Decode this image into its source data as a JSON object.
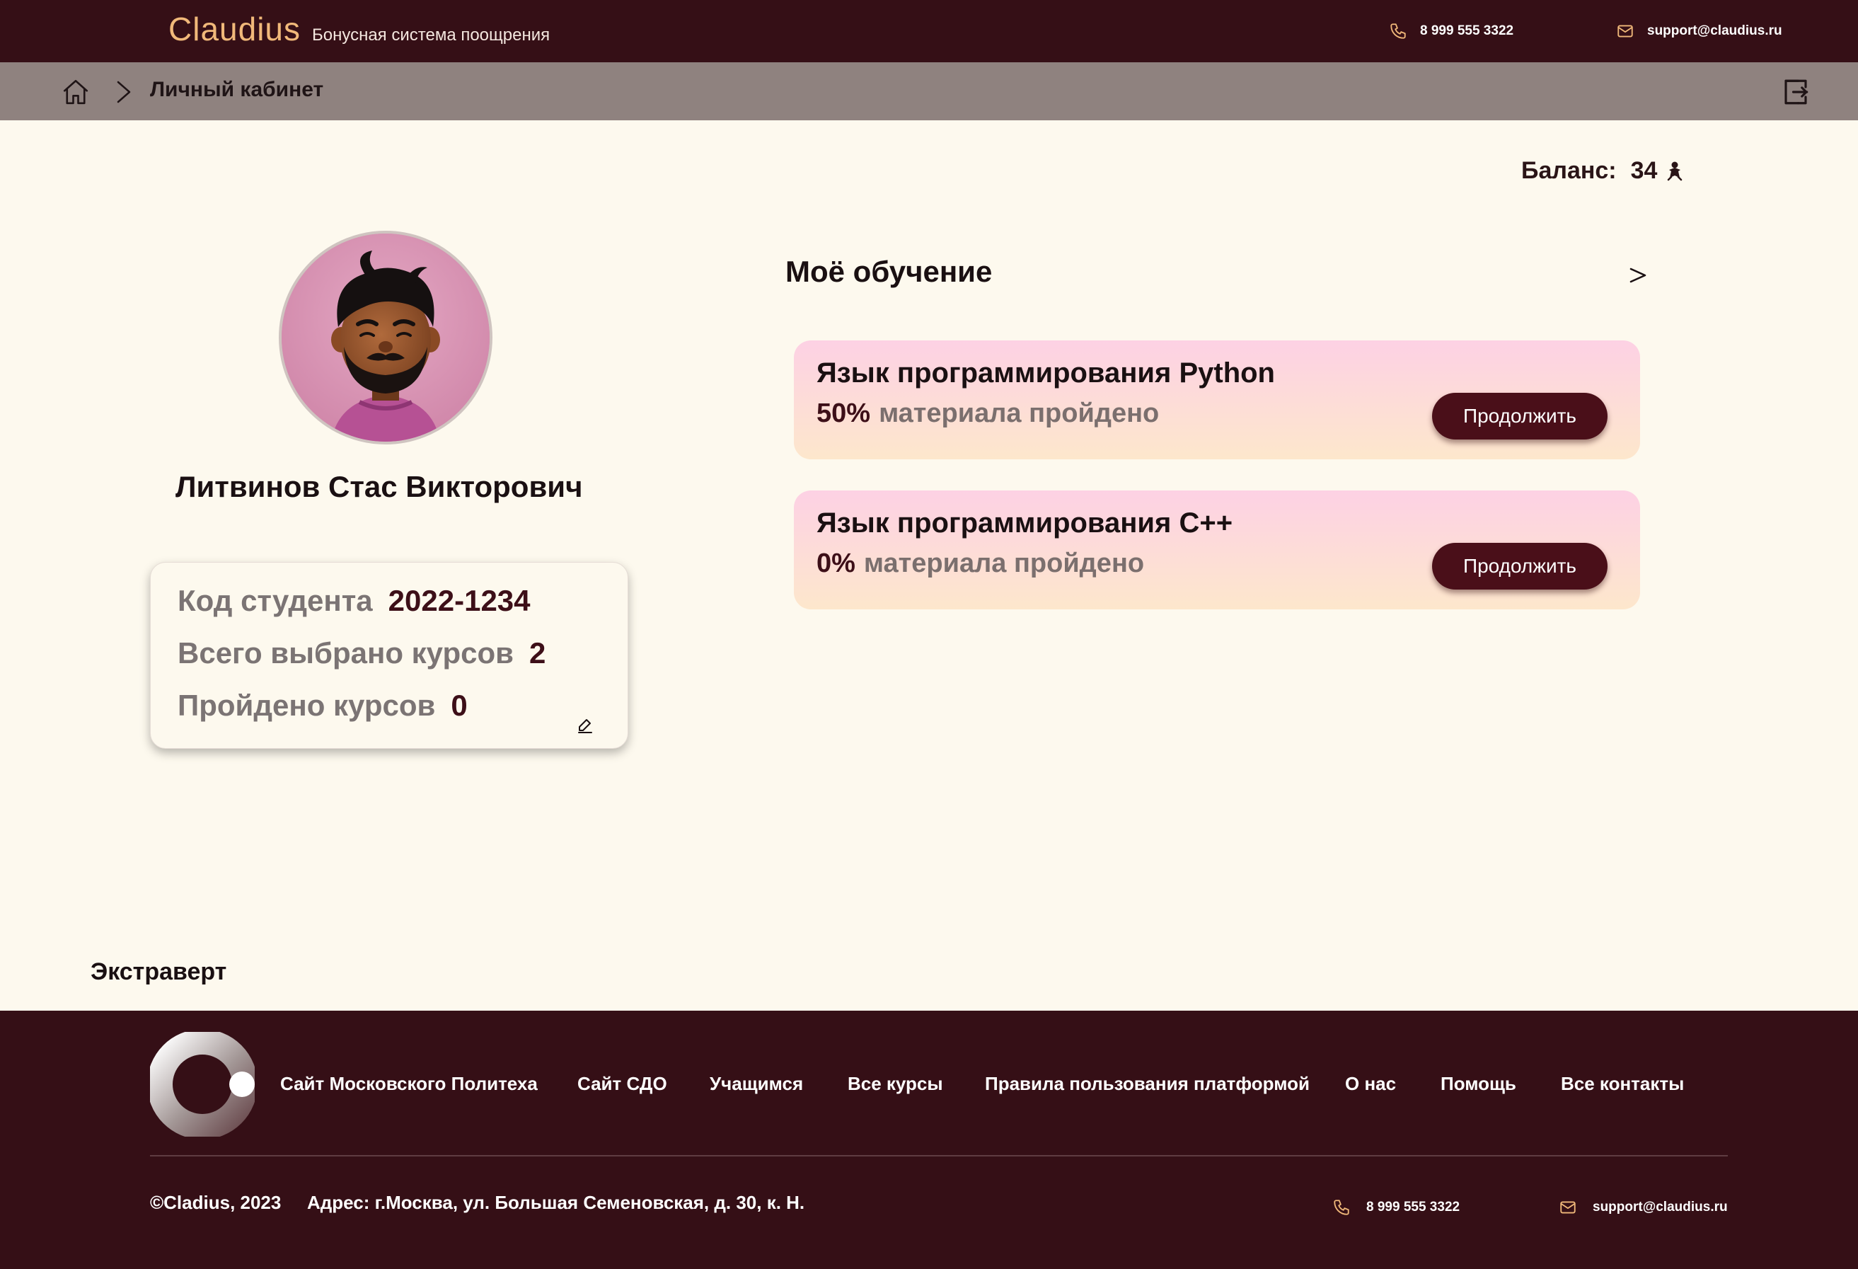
{
  "header": {
    "brand_name": "Claudius",
    "brand_subtitle": "Бонусная система поощрения",
    "phone": "8 999 555 3322",
    "email": "support@claudius.ru"
  },
  "breadcrumb": {
    "current": "Личный кабинет"
  },
  "balance": {
    "label": "Баланс:",
    "value": "34"
  },
  "profile": {
    "name": "Литвинов Стас Викторович",
    "stats": [
      {
        "label": "Код студента",
        "value": "2022-1234"
      },
      {
        "label": "Всего выбрано курсов",
        "value": "2"
      },
      {
        "label": "Пройдено курсов",
        "value": "0"
      }
    ],
    "trait": "Экстраверт"
  },
  "learning": {
    "title": "Моё обучение",
    "arrow": ">",
    "courses": [
      {
        "title": "Язык программирования Python",
        "progress": "50%",
        "progress_text": "материала пройдено",
        "button": "Продолжить"
      },
      {
        "title": "Язык программирования C++",
        "progress": "0%",
        "progress_text": "материала пройдено",
        "button": "Продолжить"
      }
    ]
  },
  "footer": {
    "nav": [
      "Сайт Московского Политеха",
      "Сайт СДО",
      "Учащимся",
      "Все курсы",
      "Правила пользования платформой",
      "О нас",
      "Помощь",
      "Все контакты"
    ],
    "copyright": "©Cladius, 2023",
    "address": "Адрес: г.Москва, ул. Большая Семеновская, д. 30, к. Н.",
    "phone": "8 999 555 3322",
    "email": "support@claudius.ru"
  },
  "colors": {
    "header_bg": "#350f16",
    "breadcrumb_bg": "#8f827f",
    "page_bg": "#fdf9ee",
    "brand_accent": "#f1b97a",
    "button_bg": "#4a0f19",
    "card_gradient_top": "#fdd1e4",
    "card_gradient_bottom": "#fde7cc"
  },
  "icons": {
    "header_phone": "phone-icon",
    "header_email": "mail-icon",
    "breadcrumb_home": "home-icon",
    "breadcrumb_separator": "chevron-right-icon",
    "logout": "logout-icon",
    "balance": "coin-figure-icon",
    "stats_edit": "pencil-icon",
    "learning_more": "chevron-right-icon",
    "footer_logo": "claudius-logo"
  }
}
